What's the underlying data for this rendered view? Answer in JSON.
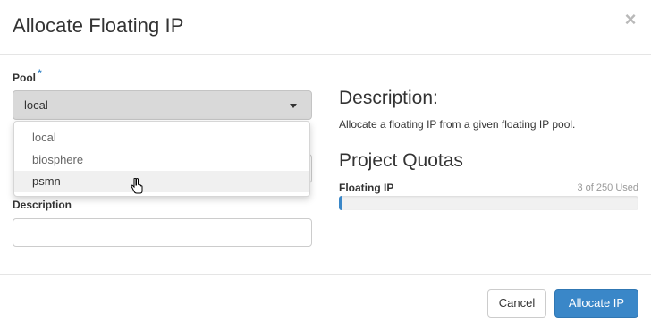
{
  "dialog": {
    "title": "Allocate Floating IP",
    "close_symbol": "×"
  },
  "pool": {
    "label": "Pool",
    "required_mark": "*",
    "selected": "local",
    "options": [
      "local",
      "biosphere",
      "psmn"
    ],
    "hovered_option": "psmn"
  },
  "description_field": {
    "label": "Description",
    "value": "",
    "placeholder": ""
  },
  "help": {
    "heading": "Description:",
    "text": "Allocate a floating IP from a given floating IP pool."
  },
  "quotas": {
    "heading": "Project Quotas",
    "items": [
      {
        "label": "Floating IP",
        "usage_text": "3 of 250 Used",
        "used": 3,
        "limit": 250
      }
    ]
  },
  "footer": {
    "cancel_label": "Cancel",
    "submit_label": "Allocate IP"
  },
  "colors": {
    "primary": "#3a87c8",
    "select_bg": "#d9d9d9"
  },
  "icons": {
    "close": "close-icon",
    "caret": "caret-down-icon",
    "cursor": "hand-pointer-icon"
  }
}
